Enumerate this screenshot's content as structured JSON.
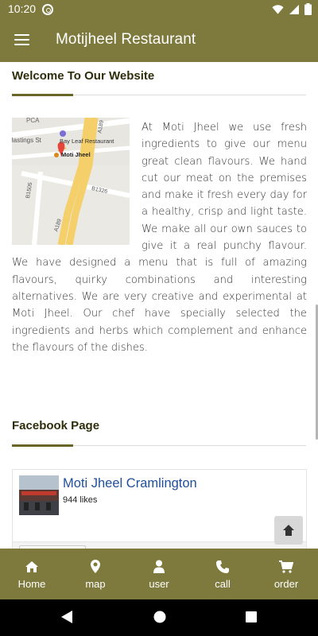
{
  "status_bar": {
    "time": "10:20",
    "icons": [
      "app-notification-icon",
      "wifi-icon",
      "signal-icon",
      "battery-icon"
    ]
  },
  "app_bar": {
    "title": "Motijheel Restaurant",
    "menu_icon": "hamburger-menu-icon"
  },
  "welcome": {
    "heading": "Welcome To Our Website",
    "text": "At Moti Jheel we use fresh ingredients to give our menu great clean flavours. We hand cut our meat on the premises and make it fresh every day for a healthy, crisp and light taste. We make all our own sauces to give it a real punchy flavour. We have designed a menu that is full of amazing flavours, quirky combinations and interesting alternatives. We are very creative and experimental at Moti Jheel. Our chef have specially selected the ingredients and herbs which complement and enhance the flavours of the dishes.",
    "map": {
      "place_labels": [
        "Bay Leaf Restaurant",
        "Moti Jheel",
        "Hastings St"
      ],
      "road_labels": [
        "A189",
        "A189",
        "B1326",
        "B1505"
      ],
      "cut_off_label": "PCA"
    }
  },
  "facebook": {
    "heading": "Facebook Page",
    "page_name": "Moti Jheel Cramlington",
    "likes": "944 likes"
  },
  "scroll_top_icon": "arrow-up-icon",
  "bottom_nav": {
    "items": [
      {
        "label": "Home",
        "icon": "home-icon"
      },
      {
        "label": "map",
        "icon": "map-marker-icon"
      },
      {
        "label": "user",
        "icon": "user-icon"
      },
      {
        "label": "call",
        "icon": "phone-icon"
      },
      {
        "label": "order",
        "icon": "cart-icon"
      }
    ]
  },
  "system_nav": [
    "back-icon",
    "home-circle-icon",
    "recents-icon"
  ],
  "colors": {
    "primary": "#7e7a3d",
    "accent_rule": "#6a6628",
    "link": "#1f4f9a"
  }
}
